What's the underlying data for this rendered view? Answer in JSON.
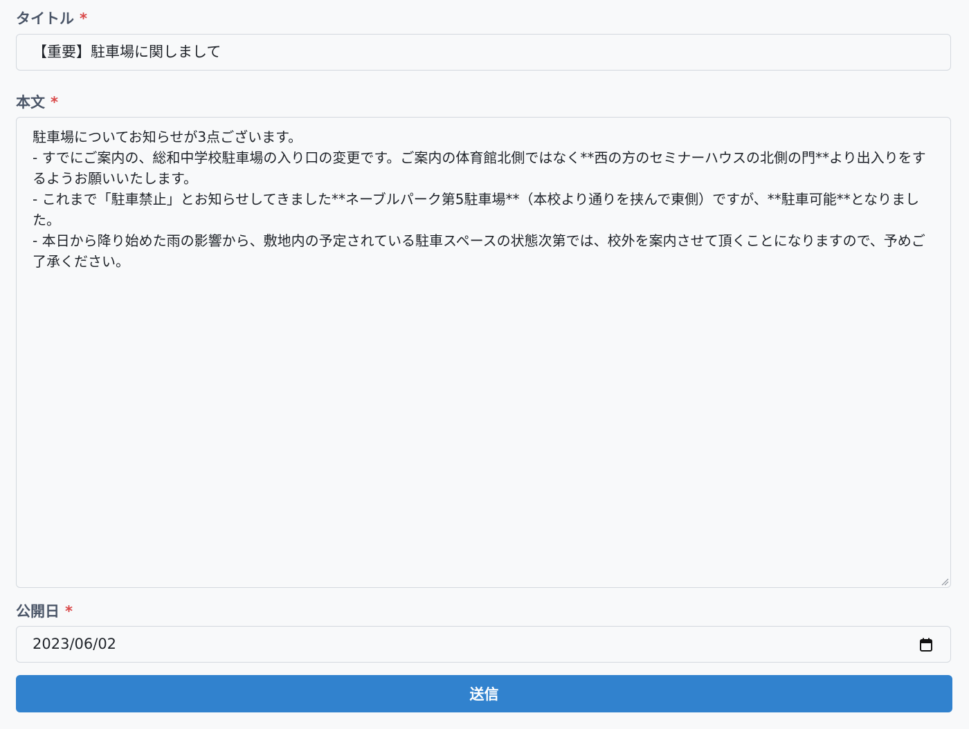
{
  "form": {
    "title_field": {
      "label": "タイトル",
      "required_mark": "*",
      "value": "【重要】駐車場に関しまして"
    },
    "body_field": {
      "label": "本文",
      "required_mark": "*",
      "value": "駐車場についてお知らせが3点ございます。\n- すでにご案内の、総和中学校駐車場の入り口の変更です。ご案内の体育館北側ではなく**西の方のセミナーハウスの北側の門**より出入りをするようお願いいたします。\n- これまで「駐車禁止」とお知らせしてきました**ネーブルパーク第5駐車場**（本校より通りを挟んで東側）ですが、**駐車可能**となりました。\n- 本日から降り始めた雨の影響から、敷地内の予定されている駐車スペースの状態次第では、校外を案内させて頂くことになりますので、予めご了承ください。"
    },
    "publish_date_field": {
      "label": "公開日",
      "required_mark": "*",
      "value": "2023/06/02",
      "icon": "calendar-icon"
    },
    "submit_label": "送信"
  },
  "colors": {
    "background": "#f8f9fa",
    "label_text": "#4a5567",
    "required": "#d94848",
    "border": "#d3d8de",
    "submit_button": "#3182ce"
  }
}
